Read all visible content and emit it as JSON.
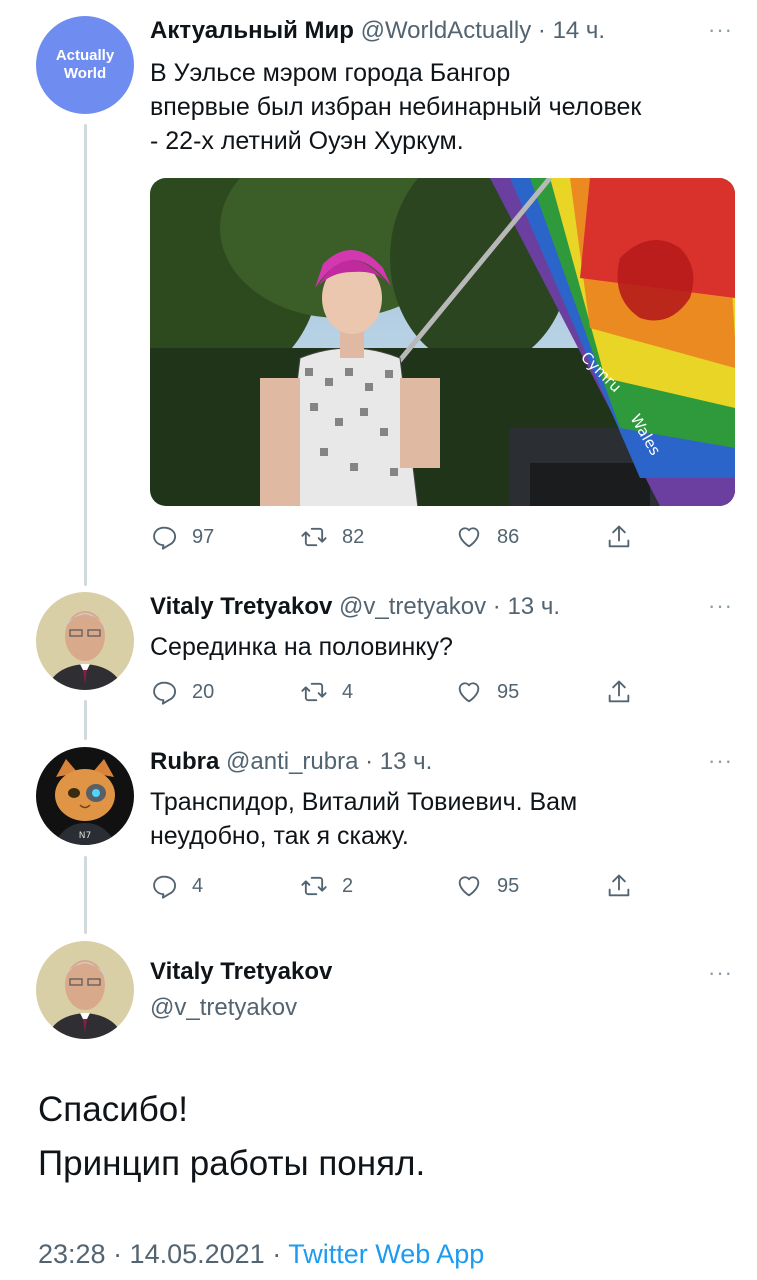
{
  "tweets": [
    {
      "display_name": "Актуальный Мир",
      "handle": "@WorldActually",
      "time": "14 ч.",
      "avatar_text_line1": "Actually",
      "avatar_text_line2": "World",
      "text_lines": [
        "В Уэльсе мэром города Бангор",
        "впервые был избран небинарный человек",
        "- 22-х летний Оуэн Хуркум."
      ],
      "image_flag_text_1": "Cymru",
      "image_flag_text_2": "Wales",
      "replies": "97",
      "retweets": "82",
      "likes": "86"
    },
    {
      "display_name": "Vitaly Tretyakov",
      "handle": "@v_tretyakov",
      "time": "13 ч.",
      "text": "Серединка на половинку?",
      "replies": "20",
      "retweets": "4",
      "likes": "95"
    },
    {
      "display_name": "Rubra",
      "handle": "@anti_rubra",
      "time": "13 ч.",
      "avatar_badge": "N7",
      "text_lines": [
        "Транспидор, Виталий Товиевич. Вам",
        "неудобно, так я скажу."
      ],
      "replies": "4",
      "retweets": "2",
      "likes": "95"
    }
  ],
  "main_tweet": {
    "display_name": "Vitaly Tretyakov",
    "handle": "@v_tretyakov",
    "line1": "Спасибо!",
    "line2": "Принцип работы понял.",
    "timestamp": "23:28 · 14.05.2021 · ",
    "app": "Twitter Web App"
  },
  "separator_dot": "·",
  "more_icon": "···",
  "colors": {
    "link": "#1d9bf0",
    "secondary_text": "#536471",
    "thread_line": "#cfd9de",
    "logo_avatar": "#6f8df0"
  },
  "icons": [
    "reply-icon",
    "retweet-icon",
    "like-icon",
    "share-icon",
    "more-icon"
  ]
}
